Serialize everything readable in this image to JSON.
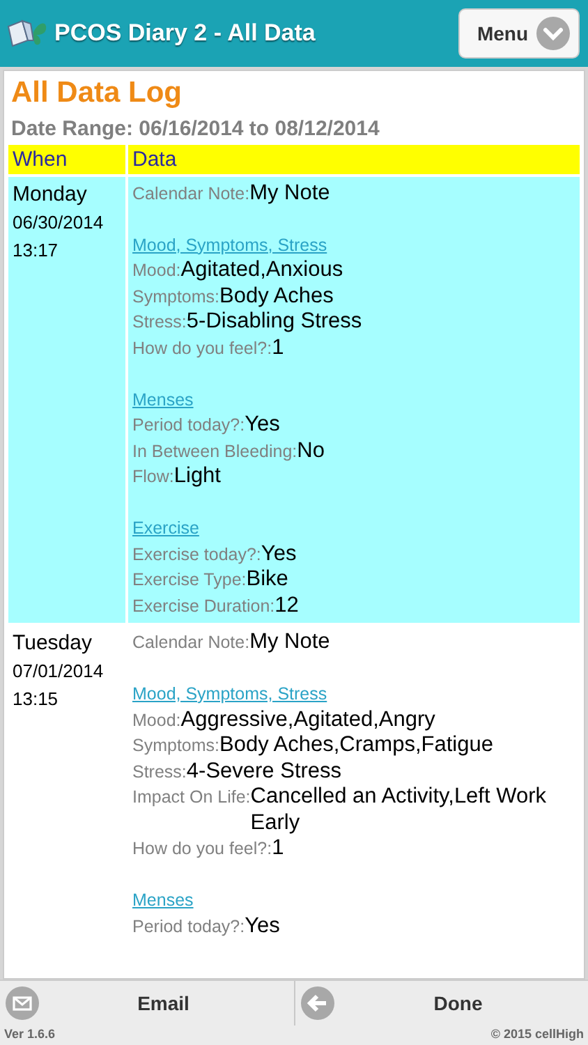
{
  "header": {
    "title": "PCOS Diary 2 - All Data",
    "menu_button": "Menu"
  },
  "page": {
    "title": "All Data Log",
    "date_range": "Date Range: 06/16/2014 to 08/12/2014"
  },
  "table": {
    "columns": [
      "When",
      "Data"
    ],
    "rows": [
      {
        "day": "Monday",
        "date": "06/30/2014",
        "time": "13:17",
        "entries": [
          {
            "kind": "field",
            "label": "Calendar Note:",
            "value": "My Note"
          },
          {
            "kind": "section",
            "title": "Mood, Symptoms, Stress"
          },
          {
            "kind": "field",
            "label": "Mood:",
            "value": "Agitated,Anxious"
          },
          {
            "kind": "field",
            "label": "Symptoms:",
            "value": "Body Aches"
          },
          {
            "kind": "field",
            "label": "Stress:",
            "value": "5-Disabling Stress"
          },
          {
            "kind": "field",
            "label": "How do you feel?:",
            "value": "1"
          },
          {
            "kind": "section",
            "title": "Menses"
          },
          {
            "kind": "field",
            "label": "Period today?:",
            "value": "Yes"
          },
          {
            "kind": "field",
            "label": "In Between Bleeding:",
            "value": "No"
          },
          {
            "kind": "field",
            "label": "Flow:",
            "value": "Light"
          },
          {
            "kind": "section",
            "title": "Exercise"
          },
          {
            "kind": "field",
            "label": "Exercise today?:",
            "value": "Yes"
          },
          {
            "kind": "field",
            "label": "Exercise Type:",
            "value": "Bike"
          },
          {
            "kind": "field",
            "label": "Exercise Duration:",
            "value": "12"
          }
        ]
      },
      {
        "day": "Tuesday",
        "date": "07/01/2014",
        "time": "13:15",
        "entries": [
          {
            "kind": "field",
            "label": "Calendar Note:",
            "value": "My Note"
          },
          {
            "kind": "section",
            "title": "Mood, Symptoms, Stress"
          },
          {
            "kind": "field",
            "label": "Mood:",
            "value": "Aggressive,Agitated,Angry"
          },
          {
            "kind": "field",
            "label": "Symptoms:",
            "value": "Body Aches,Cramps,Fatigue"
          },
          {
            "kind": "field",
            "label": "Stress:",
            "value": "4-Severe Stress"
          },
          {
            "kind": "field",
            "label": "Impact On Life:",
            "value": "Cancelled an Activity,Left Work Early"
          },
          {
            "kind": "field",
            "label": "How do you feel?:",
            "value": "1"
          },
          {
            "kind": "section",
            "title": "Menses"
          },
          {
            "kind": "field",
            "label": "Period today?:",
            "value": "Yes"
          }
        ]
      }
    ]
  },
  "footer": {
    "email_button": "Email",
    "done_button": "Done",
    "version": "Ver 1.6.6",
    "copyright": "© 2015 cellHigh"
  }
}
